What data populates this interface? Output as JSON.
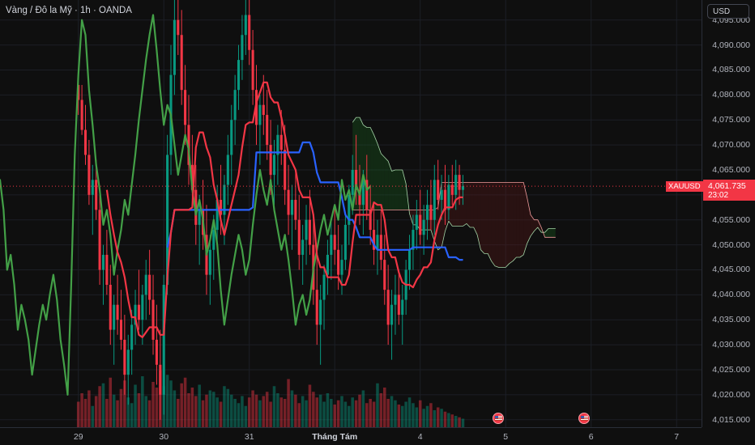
{
  "header": {
    "title": "Vàng / Đô la Mỹ · 1h · OANDA"
  },
  "price_axis": {
    "currency": "USD"
  },
  "last_price": {
    "symbol": "XAUUSD",
    "price": "4,061.735",
    "countdown": "23:02",
    "color": "#f23645"
  },
  "events": [
    {
      "icon": "us-flag-icon"
    },
    {
      "icon": "us-flag-icon"
    }
  ],
  "colors": {
    "background": "#0f0f0f",
    "up": "#089981",
    "down": "#f23645",
    "conversion": "#f23645",
    "base": "#2962ff",
    "lagging": "#43a047"
  },
  "chart_data": {
    "type": "candlestick",
    "symbol": "XAUUSD",
    "timeframe": "1h",
    "y_ticks": [
      "4,015.000",
      "4,020.000",
      "4,025.000",
      "4,030.000",
      "4,035.000",
      "4,040.000",
      "4,045.000",
      "4,050.000",
      "4,055.000",
      "4,060.000",
      "4,065.000",
      "4,070.000",
      "4,075.000",
      "4,080.000",
      "4,085.000",
      "4,090.000",
      "4,095.000"
    ],
    "ylim": [
      4013.5,
      4099
    ],
    "x_ticks": [
      {
        "label": "29",
        "bar": 0
      },
      {
        "label": "30",
        "bar": 24
      },
      {
        "label": "31",
        "bar": 48
      },
      {
        "label": "Tháng Tám",
        "bar": 72,
        "bold": true
      },
      {
        "label": "4",
        "bar": 96
      },
      {
        "label": "5",
        "bar": 120
      },
      {
        "label": "6",
        "bar": 144
      },
      {
        "label": "7",
        "bar": 168
      }
    ],
    "x_range_bars": [
      -22,
      175
    ],
    "last_bar": 108,
    "cloud_end_bar": 134,
    "event_bars": [
      118,
      142
    ],
    "candles_ohlc": [
      [
        4082,
        4084,
        4076,
        4079
      ],
      [
        4079,
        4082,
        4072,
        4073
      ],
      [
        4073,
        4078,
        4066,
        4068
      ],
      [
        4068,
        4071,
        4058,
        4060
      ],
      [
        4060,
        4066,
        4052,
        4063
      ],
      [
        4063,
        4067,
        4055,
        4057
      ],
      [
        4057,
        4060,
        4042,
        4045
      ],
      [
        4045,
        4050,
        4038,
        4048
      ],
      [
        4048,
        4053,
        4040,
        4042
      ],
      [
        4042,
        4046,
        4030,
        4033
      ],
      [
        4033,
        4040,
        4026,
        4038
      ],
      [
        4038,
        4044,
        4032,
        4035
      ],
      [
        4035,
        4041,
        4029,
        4031
      ],
      [
        4031,
        4036,
        4020,
        4024
      ],
      [
        4024,
        4032,
        4018,
        4029
      ],
      [
        4029,
        4037,
        4024,
        4034
      ],
      [
        4034,
        4041,
        4030,
        4038
      ],
      [
        4038,
        4045,
        4033,
        4035
      ],
      [
        4035,
        4042,
        4030,
        4040
      ],
      [
        4040,
        4047,
        4035,
        4044
      ],
      [
        4044,
        4049,
        4036,
        4039
      ],
      [
        4039,
        4044,
        4028,
        4031
      ],
      [
        4031,
        4038,
        4022,
        4026
      ],
      [
        4026,
        4033,
        4015,
        4020
      ],
      [
        4020,
        4044,
        4016,
        4042
      ],
      [
        4042,
        4072,
        4040,
        4068
      ],
      [
        4068,
        4090,
        4064,
        4084
      ],
      [
        4084,
        4099,
        4080,
        4095
      ],
      [
        4095,
        4099,
        4088,
        4092
      ],
      [
        4092,
        4097,
        4078,
        4081
      ],
      [
        4081,
        4086,
        4070,
        4074
      ],
      [
        4074,
        4080,
        4062,
        4066
      ],
      [
        4066,
        4072,
        4058,
        4061
      ],
      [
        4061,
        4066,
        4050,
        4054
      ],
      [
        4054,
        4060,
        4046,
        4057
      ],
      [
        4057,
        4063,
        4049,
        4052
      ],
      [
        4052,
        4058,
        4040,
        4044
      ],
      [
        4044,
        4052,
        4038,
        4049
      ],
      [
        4049,
        4056,
        4043,
        4053
      ],
      [
        4053,
        4062,
        4049,
        4059
      ],
      [
        4059,
        4066,
        4052,
        4056
      ],
      [
        4056,
        4064,
        4050,
        4062
      ],
      [
        4062,
        4072,
        4058,
        4068
      ],
      [
        4068,
        4078,
        4062,
        4075
      ],
      [
        4075,
        4084,
        4070,
        4081
      ],
      [
        4081,
        4090,
        4077,
        4087
      ],
      [
        4087,
        4096,
        4083,
        4092
      ],
      [
        4092,
        4099,
        4088,
        4096
      ],
      [
        4096,
        4099,
        4086,
        4089
      ],
      [
        4089,
        4093,
        4078,
        4081
      ],
      [
        4081,
        4086,
        4070,
        4074
      ],
      [
        4074,
        4080,
        4066,
        4078
      ],
      [
        4078,
        4084,
        4072,
        4076
      ],
      [
        4076,
        4081,
        4067,
        4070
      ],
      [
        4070,
        4075,
        4060,
        4064
      ],
      [
        4064,
        4071,
        4058,
        4068
      ],
      [
        4068,
        4074,
        4062,
        4072
      ],
      [
        4072,
        4077,
        4066,
        4069
      ],
      [
        4069,
        4074,
        4058,
        4061
      ],
      [
        4061,
        4066,
        4052,
        4056
      ],
      [
        4056,
        4062,
        4049,
        4059
      ],
      [
        4059,
        4065,
        4053,
        4055
      ],
      [
        4055,
        4060,
        4045,
        4048
      ],
      [
        4048,
        4054,
        4042,
        4051
      ],
      [
        4051,
        4058,
        4046,
        4055
      ],
      [
        4055,
        4061,
        4048,
        4050
      ],
      [
        4050,
        4055,
        4038,
        4041
      ],
      [
        4041,
        4048,
        4030,
        4034
      ],
      [
        4034,
        4042,
        4026,
        4039
      ],
      [
        4039,
        4046,
        4033,
        4044
      ],
      [
        4044,
        4051,
        4040,
        4048
      ],
      [
        4048,
        4055,
        4043,
        4052
      ],
      [
        4052,
        4058,
        4046,
        4049
      ],
      [
        4049,
        4054,
        4041,
        4044
      ],
      [
        4044,
        4050,
        4040,
        4047
      ],
      [
        4047,
        4056,
        4045,
        4054
      ],
      [
        4054,
        4062,
        4050,
        4060
      ],
      [
        4060,
        4068,
        4056,
        4065
      ],
      [
        4065,
        4072,
        4058,
        4061
      ],
      [
        4061,
        4066,
        4054,
        4058
      ],
      [
        4058,
        4065,
        4052,
        4063
      ],
      [
        4063,
        4068,
        4055,
        4057
      ],
      [
        4057,
        4062,
        4050,
        4053
      ],
      [
        4053,
        4058,
        4046,
        4049
      ],
      [
        4049,
        4055,
        4044,
        4052
      ],
      [
        4052,
        4057,
        4045,
        4047
      ],
      [
        4047,
        4052,
        4038,
        4041
      ],
      [
        4041,
        4046,
        4030,
        4034
      ],
      [
        4034,
        4041,
        4027,
        4038
      ],
      [
        4038,
        4044,
        4032,
        4040
      ],
      [
        4040,
        4045,
        4034,
        4036
      ],
      [
        4036,
        4042,
        4030,
        4039
      ],
      [
        4039,
        4047,
        4036,
        4045
      ],
      [
        4045,
        4052,
        4041,
        4049
      ],
      [
        4049,
        4056,
        4045,
        4053
      ],
      [
        4053,
        4059,
        4049,
        4056
      ],
      [
        4056,
        4061,
        4050,
        4052
      ],
      [
        4052,
        4058,
        4048,
        4055
      ],
      [
        4055,
        4061,
        4051,
        4058
      ],
      [
        4058,
        4063,
        4053,
        4055
      ],
      [
        4055,
        4066,
        4052,
        4063
      ],
      [
        4063,
        4067,
        4057,
        4059
      ],
      [
        4059,
        4064,
        4055,
        4061
      ],
      [
        4061,
        4066,
        4054,
        4057
      ],
      [
        4057,
        4064,
        4055,
        4062
      ],
      [
        4062,
        4066,
        4058,
        4060
      ],
      [
        4060,
        4067,
        4057,
        4064
      ],
      [
        4064,
        4066,
        4058,
        4061
      ],
      [
        4061,
        4064,
        4058,
        4061.735
      ]
    ],
    "volumes": [
      36,
      48,
      40,
      52,
      30,
      44,
      58,
      62,
      40,
      70,
      46,
      38,
      54,
      66,
      42,
      34,
      60,
      48,
      72,
      44,
      38,
      64,
      56,
      80,
      58,
      74,
      66,
      52,
      40,
      62,
      70,
      48,
      56,
      44,
      60,
      38,
      46,
      52,
      50,
      42,
      36,
      58,
      54,
      46,
      40,
      34,
      44,
      30,
      42,
      52,
      46,
      38,
      44,
      50,
      36,
      58,
      48,
      42,
      40,
      68,
      52,
      46,
      34,
      44,
      38,
      60,
      50,
      42,
      46,
      36,
      48,
      40,
      32,
      38,
      44,
      36,
      30,
      42,
      38,
      46,
      52,
      34,
      40,
      36,
      62,
      48,
      56,
      40,
      44,
      38,
      32,
      30,
      36,
      42,
      34,
      28,
      38,
      26,
      30,
      34,
      24,
      28,
      26,
      22,
      20,
      18,
      16,
      14,
      12
    ],
    "series": [
      {
        "indicator": "ichimoku",
        "line": "tenkan",
        "shift": 0,
        "values": []
      },
      {
        "indicator": "ichimoku",
        "line": "kijun",
        "shift": 0,
        "values": []
      },
      {
        "indicator": "ichimoku",
        "line": "chikou",
        "shift": -26,
        "values": []
      },
      {
        "indicator": "ichimoku",
        "line": "senkou_a",
        "shift": 26,
        "values": []
      },
      {
        "indicator": "ichimoku",
        "line": "senkou_b",
        "shift": 26,
        "values": []
      }
    ],
    "ichimoku_params": {
      "conversion": 9,
      "base": 26,
      "span_b": 52,
      "displacement": 26
    }
  }
}
